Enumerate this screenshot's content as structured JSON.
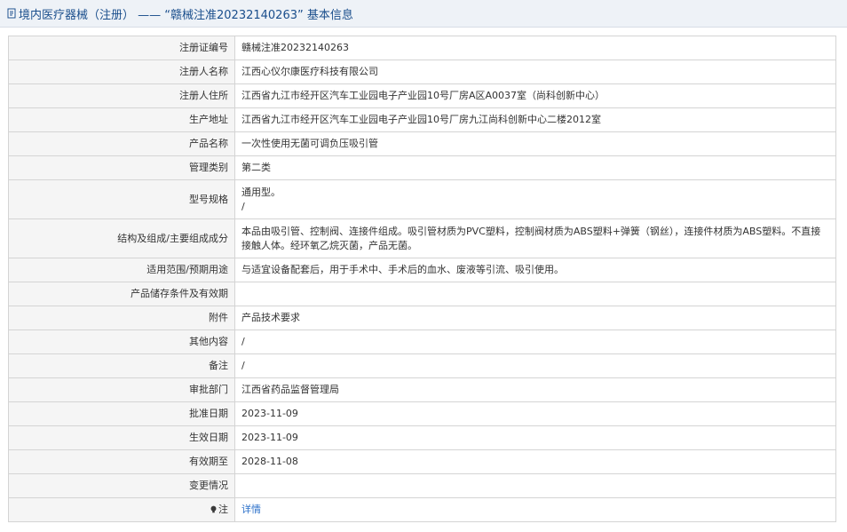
{
  "header": {
    "title": "境内医疗器械（注册） —— “赣械注准20232140263” 基本信息"
  },
  "rows": [
    {
      "label": "注册证编号",
      "value": "赣械注准20232140263"
    },
    {
      "label": "注册人名称",
      "value": "江西心仪尔康医疗科技有限公司"
    },
    {
      "label": "注册人住所",
      "value": "江西省九江市经开区汽车工业园电子产业园10号厂房A区A0037室（尚科创新中心）"
    },
    {
      "label": "生产地址",
      "value": "江西省九江市经开区汽车工业园电子产业园10号厂房九江尚科创新中心二楼2012室"
    },
    {
      "label": "产品名称",
      "value": "一次性使用无菌可调负压吸引管"
    },
    {
      "label": "管理类别",
      "value": "第二类"
    },
    {
      "label": "型号规格",
      "value_line1": "通用型。",
      "value_line2": "/"
    },
    {
      "label": "结构及组成/主要组成成分",
      "value": "本品由吸引管、控制阀、连接件组成。吸引管材质为PVC塑料，控制阀材质为ABS塑料+弹簧（钢丝），连接件材质为ABS塑料。不直接接触人体。经环氧乙烷灭菌，产品无菌。"
    },
    {
      "label": "适用范围/预期用途",
      "value": "与适宜设备配套后，用于手术中、手术后的血水、废液等引流、吸引使用。"
    },
    {
      "label": "产品储存条件及有效期",
      "value": ""
    },
    {
      "label": "附件",
      "value": "产品技术要求"
    },
    {
      "label": "其他内容",
      "value": "/"
    },
    {
      "label": "备注",
      "value": "/"
    },
    {
      "label": "审批部门",
      "value": "江西省药品监督管理局"
    },
    {
      "label": "批准日期",
      "value": "2023-11-09"
    },
    {
      "label": "生效日期",
      "value": "2023-11-09"
    },
    {
      "label": "有效期至",
      "value": "2028-11-08"
    },
    {
      "label": "变更情况",
      "value": ""
    },
    {
      "label": "注",
      "value": "详情"
    }
  ],
  "icons": {
    "header": "document-icon",
    "note": "lightbulb-icon"
  },
  "colors": {
    "header_text": "#1a4e8c",
    "link": "#2a6fc9",
    "label_bg": "#f5f5f5"
  }
}
